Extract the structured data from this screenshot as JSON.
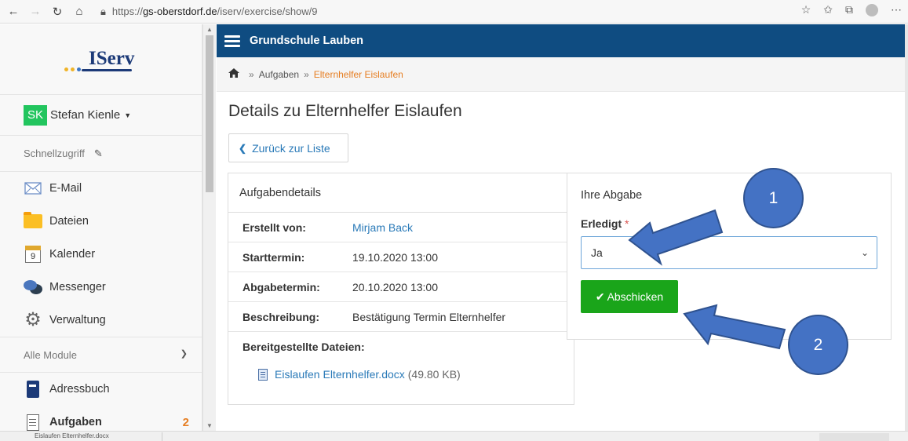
{
  "browser": {
    "url_prefix": "https://",
    "url_host": "gs-oberstdorf.de",
    "url_path": "/iserv/exercise/show/9"
  },
  "sidebar": {
    "logo": "IServ",
    "user_initials": "SK",
    "user_name": "Stefan Kienle",
    "quick_access_label": "Schnellzugriff",
    "items": [
      {
        "label": "E-Mail",
        "icon": "mail-icon"
      },
      {
        "label": "Dateien",
        "icon": "folder-icon"
      },
      {
        "label": "Kalender",
        "icon": "calendar-icon",
        "day": "9"
      },
      {
        "label": "Messenger",
        "icon": "chat-bubbles-icon"
      },
      {
        "label": "Verwaltung",
        "icon": "gear-icon"
      }
    ],
    "modules_label": "Alle Module",
    "modules": [
      {
        "label": "Adressbuch",
        "icon": "address-book-icon"
      },
      {
        "label": "Aufgaben",
        "icon": "clipboard-icon",
        "badge": "2"
      }
    ]
  },
  "header": {
    "school_name": "Grundschule Lauben"
  },
  "breadcrumb": {
    "items": [
      "Aufgaben",
      "Elternhelfer Eislaufen"
    ],
    "separator": "»"
  },
  "page": {
    "title": "Details zu Elternhelfer Eislaufen",
    "back_button": "Zurück zur Liste"
  },
  "details": {
    "heading": "Aufgabendetails",
    "rows": [
      {
        "label": "Erstellt von:",
        "value": "Mirjam Back"
      },
      {
        "label": "Starttermin:",
        "value": "19.10.2020 13:00"
      },
      {
        "label": "Abgabetermin:",
        "value": "20.10.2020 13:00"
      },
      {
        "label": "Beschreibung:",
        "value": "Bestätigung Termin Elternhelfer"
      }
    ],
    "files_heading": "Bereitgestellte Dateien:",
    "file_name": "Eislaufen Elternhelfer.docx",
    "file_size": "(49.80 KB)"
  },
  "submission": {
    "heading": "Ihre Abgabe",
    "field_label": "Erledigt",
    "required_mark": "*",
    "selected_value": "Ja",
    "submit_label": "Abschicken"
  },
  "annotations": {
    "step1": "1",
    "step2": "2",
    "color": "#4472c4"
  },
  "statusbar": {
    "text": "Eislaufen Elternhelfer.docx"
  }
}
